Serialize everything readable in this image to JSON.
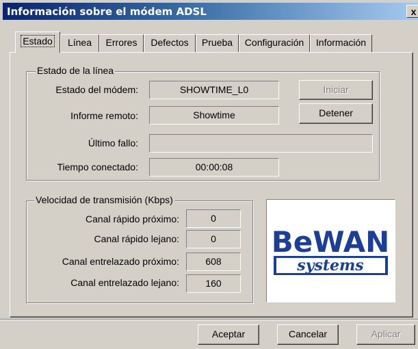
{
  "window": {
    "title": "Información sobre el módem ADSL",
    "close_label": "x"
  },
  "tabs": [
    {
      "label": "Estado",
      "active": true
    },
    {
      "label": "Línea"
    },
    {
      "label": "Errores"
    },
    {
      "label": "Defectos"
    },
    {
      "label": "Prueba"
    },
    {
      "label": "Configuración"
    },
    {
      "label": "Información"
    }
  ],
  "line_status": {
    "legend": "Estado de la línea",
    "modem_state_label": "Estado del módem:",
    "modem_state_value": "SHOWTIME_L0",
    "remote_report_label": "Informe remoto:",
    "remote_report_value": "Showtime",
    "last_failure_label": "Último fallo:",
    "last_failure_value": "",
    "connected_time_label": "Tiempo conectado:",
    "connected_time_value": "00:00:08",
    "start_button": "Iniciar",
    "stop_button": "Detener"
  },
  "speed": {
    "legend": "Velocidad de transmisión (Kbps)",
    "rows": [
      {
        "label": "Canal rápido próximo:",
        "value": "0"
      },
      {
        "label": "Canal rápido lejano:",
        "value": "0"
      },
      {
        "label": "Canal entrelazado próximo:",
        "value": "608"
      },
      {
        "label": "Canal entrelazado lejano:",
        "value": "160"
      }
    ]
  },
  "logo": {
    "top_text": "BeWAN",
    "bottom_text": "systems",
    "brand_color": "#1c3f94"
  },
  "footer": {
    "ok_button": "Aceptar",
    "cancel_button": "Cancelar",
    "apply_button": "Aplicar"
  }
}
